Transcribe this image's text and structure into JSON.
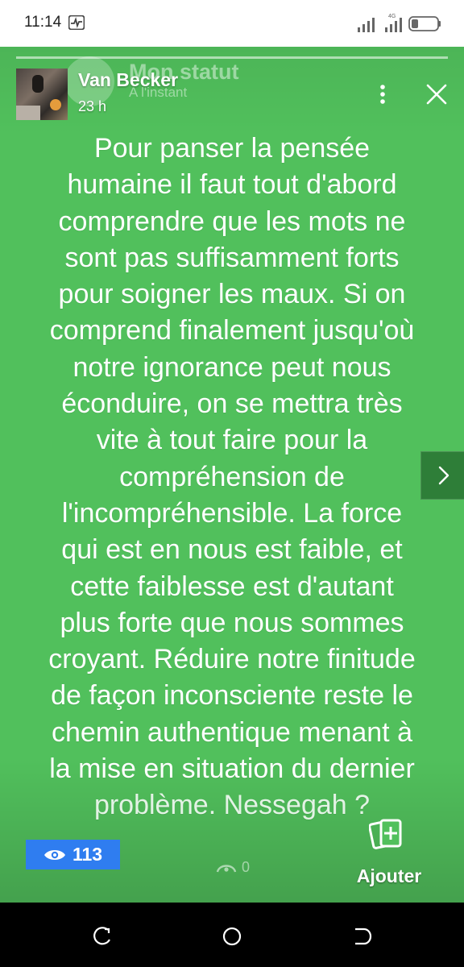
{
  "status_bar": {
    "time": "11:14",
    "network_label": "4G",
    "icons": [
      "activity-icon",
      "signal-icon",
      "signal-icon",
      "battery-icon"
    ]
  },
  "story": {
    "background_color": "#51c05c",
    "owner": {
      "name": "Van Becker",
      "posted": "23 h"
    },
    "ghost": {
      "title": "Mon statut",
      "subtitle": "A l'instant"
    },
    "text_lines": [
      "Pour panser la pensée",
      "humaine il faut tout d'abord",
      "comprendre que les mots ne",
      "sont pas suffisamment forts",
      "pour soigner les maux. Si on",
      "comprend finalement jusqu'où",
      "notre ignorance peut nous",
      "éconduire, on se mettra très",
      "vite à tout faire pour la",
      "compréhension de",
      "l'incompréhensible. La force",
      "qui est en nous est faible, et",
      "cette faiblesse est d'autant",
      "plus forte que nous sommes",
      "croyant. Réduire notre finitude",
      "de façon inconsciente reste le",
      "chemin authentique menant à",
      "la mise en situation du dernier",
      "problème. Nessegah ?"
    ]
  },
  "footer": {
    "views_count": "113",
    "replies_count": "0",
    "add_label": "Ajouter"
  },
  "colors": {
    "views_badge": "#2f7df0",
    "next_button": "#2e7e38"
  }
}
